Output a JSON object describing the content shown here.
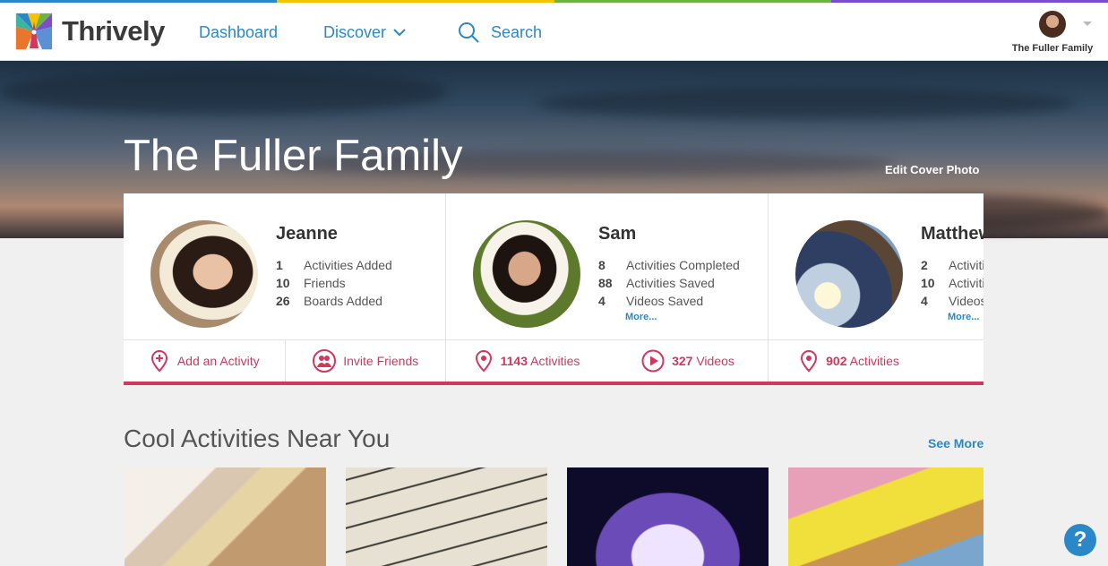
{
  "brand": {
    "name": "Thrively"
  },
  "nav": {
    "dashboard": "Dashboard",
    "discover": "Discover",
    "search": "Search"
  },
  "user": {
    "name": "The Fuller Family"
  },
  "hero": {
    "title": "The Fuller Family",
    "edit_cover": "Edit Cover Photo"
  },
  "members": [
    {
      "name": "Jeanne",
      "stats": [
        {
          "num": "1",
          "label": "Activities Added"
        },
        {
          "num": "10",
          "label": "Friends"
        },
        {
          "num": "26",
          "label": "Boards Added"
        }
      ],
      "actions": [
        {
          "label": "Add an Activity",
          "icon": "map-pin-plus-icon"
        },
        {
          "label": "Invite Friends",
          "icon": "friends-icon"
        }
      ]
    },
    {
      "name": "Sam",
      "stats": [
        {
          "num": "8",
          "label": "Activities Completed"
        },
        {
          "num": "88",
          "label": "Activities Saved"
        },
        {
          "num": "4",
          "label": "Videos Saved"
        }
      ],
      "more": "More...",
      "actions": [
        {
          "count": "1143",
          "label": "Activities",
          "icon": "map-pin-icon"
        },
        {
          "count": "327",
          "label": "Videos",
          "icon": "play-icon"
        }
      ]
    },
    {
      "name": "Matthew",
      "stats": [
        {
          "num": "2",
          "label": "Activities"
        },
        {
          "num": "10",
          "label": "Activities"
        },
        {
          "num": "4",
          "label": "Videos"
        }
      ],
      "more": "More...",
      "actions": [
        {
          "count": "902",
          "label": "Activities",
          "icon": "map-pin-icon"
        },
        {
          "count": "",
          "label": "",
          "icon": "play-icon"
        }
      ]
    }
  ],
  "section": {
    "title": "Cool Activities Near You",
    "see_more": "See More"
  },
  "help": {
    "label": "?"
  },
  "colors": {
    "accent": "#d2375e",
    "link": "#2b88c8",
    "stripes": [
      "#2b88c8",
      "#f5c400",
      "#6db33f",
      "#7b4fc9"
    ]
  }
}
